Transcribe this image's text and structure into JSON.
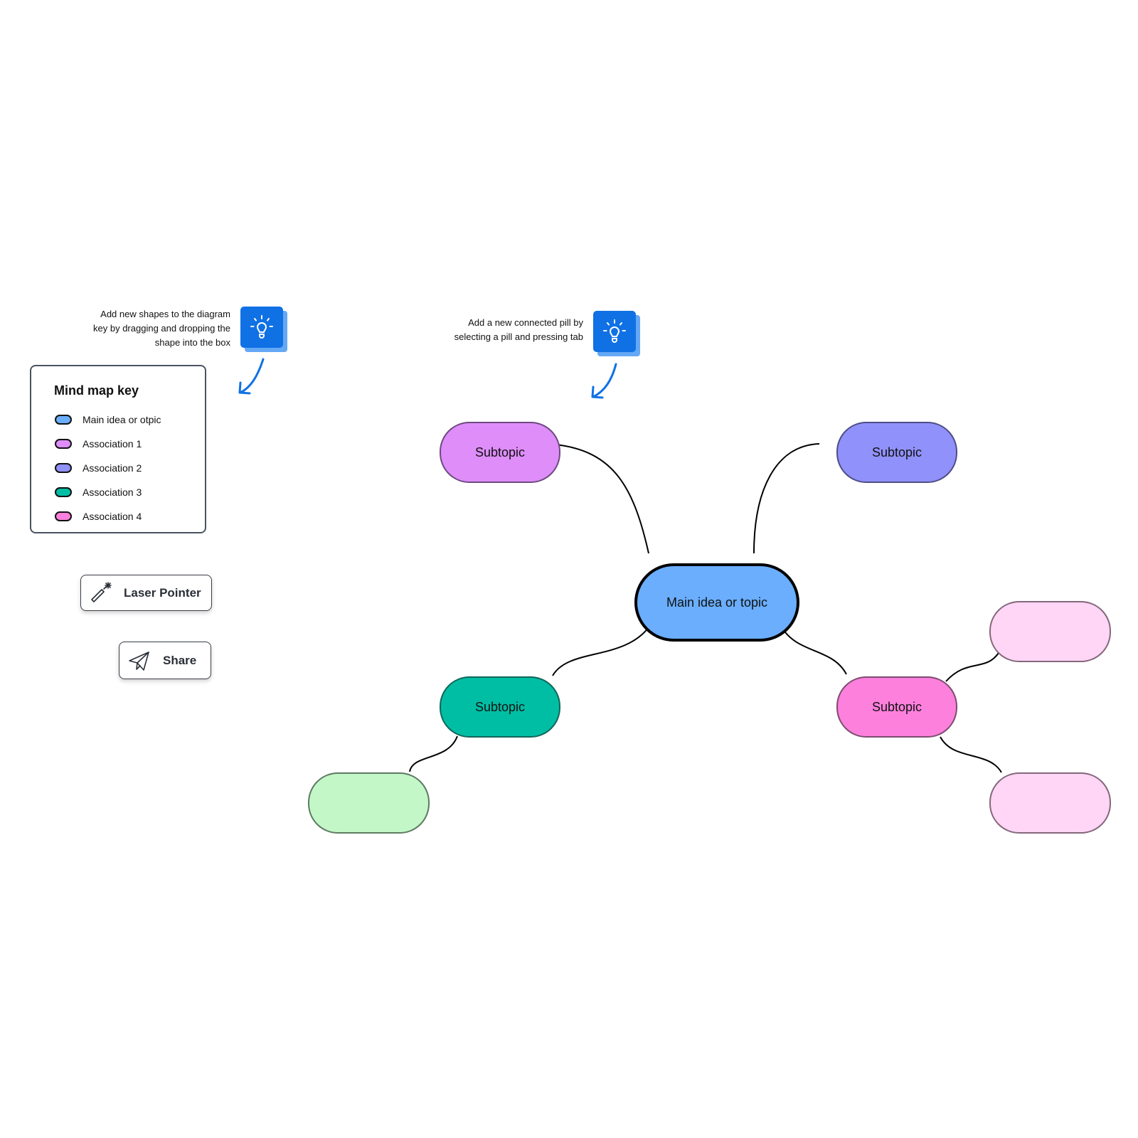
{
  "tips": [
    {
      "lines": [
        "Add new shapes to the diagram",
        "key by dragging and dropping the",
        "shape into the box"
      ],
      "icon": "lightbulb-icon"
    },
    {
      "lines": [
        "Add a new connected pill by",
        "selecting a pill and pressing tab"
      ],
      "icon": "lightbulb-icon"
    }
  ],
  "key": {
    "title": "Mind map key",
    "items": [
      {
        "label": "Main idea or otpic",
        "color": "#6aaefd"
      },
      {
        "label": "Association 1",
        "color": "#de8df9"
      },
      {
        "label": "Association 2",
        "color": "#9191fb"
      },
      {
        "label": "Association 3",
        "color": "#00bea4"
      },
      {
        "label": "Association 4",
        "color": "#fe80dd"
      }
    ]
  },
  "buttons": {
    "laser_pointer": {
      "label": "Laser Pointer",
      "icon": "laser-pointer-icon"
    },
    "share": {
      "label": "Share",
      "icon": "paper-plane-icon"
    }
  },
  "mindmap": {
    "main": {
      "label": "Main idea or topic",
      "fill": "#6aaefd",
      "stroke": "#000000"
    },
    "subtopics": [
      {
        "id": "assoc1",
        "label": "Subtopic",
        "fill": "#de8df9",
        "stroke": "#6e4a80"
      },
      {
        "id": "assoc2",
        "label": "Subtopic",
        "fill": "#9191fb",
        "stroke": "#4e4e87"
      },
      {
        "id": "assoc3",
        "label": "Subtopic",
        "fill": "#00bea4",
        "stroke": "#12665a"
      },
      {
        "id": "assoc4",
        "label": "Subtopic",
        "fill": "#fe80dd",
        "stroke": "#7c4d70"
      }
    ],
    "children": [
      {
        "parent": "assoc3",
        "label": "",
        "fill": "#c3f7c8",
        "stroke": "#5e7a62"
      },
      {
        "parent": "assoc4",
        "label": "",
        "fill": "#ffd6f5",
        "stroke": "#84687c"
      },
      {
        "parent": "assoc4",
        "label": "",
        "fill": "#ffd6f5",
        "stroke": "#84687c"
      }
    ],
    "connector_color": "#000000",
    "arrow_color": "#1071e5"
  }
}
